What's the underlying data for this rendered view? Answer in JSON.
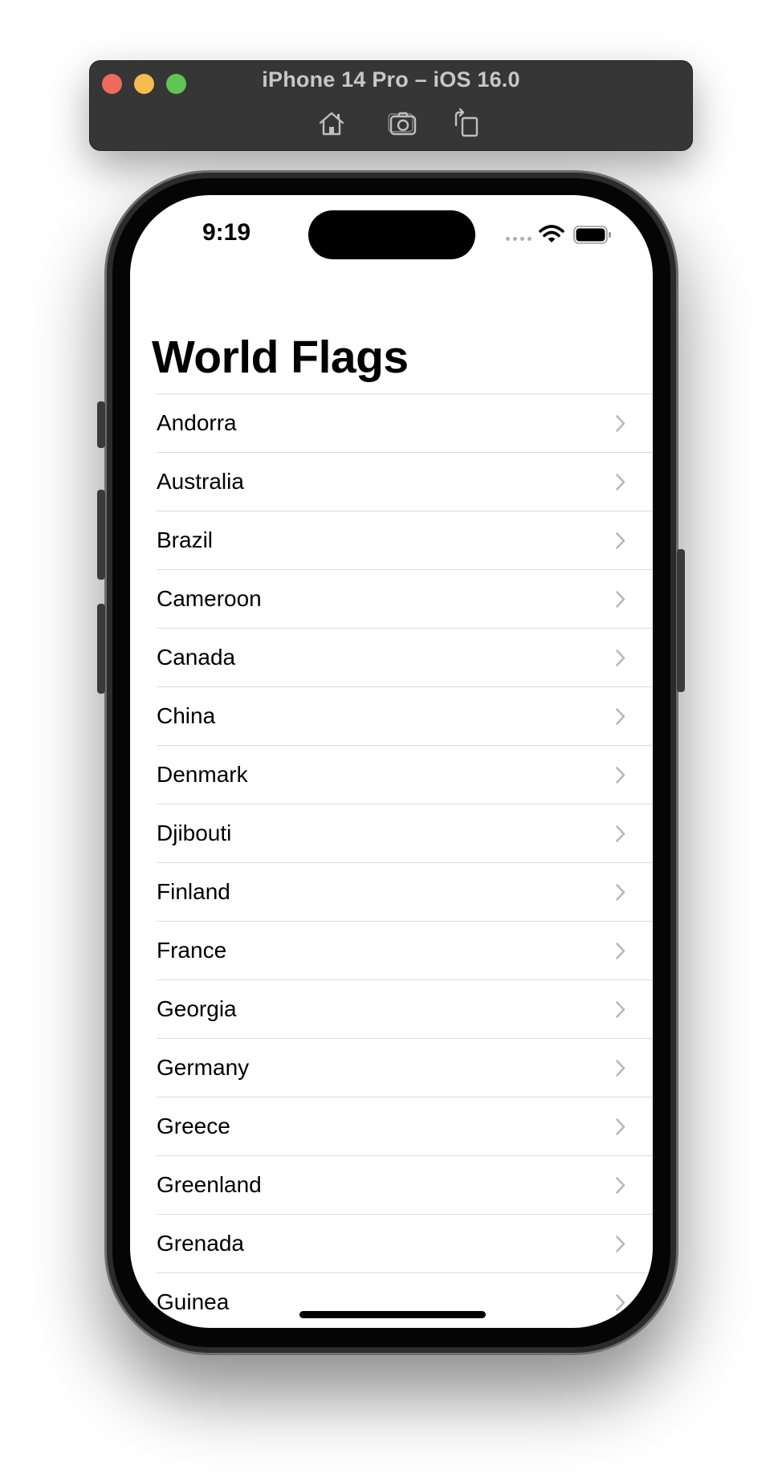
{
  "simulator": {
    "title": "iPhone 14 Pro – iOS 16.0",
    "toolbar_icons": [
      "home-icon",
      "screenshot-icon",
      "rotate-icon"
    ]
  },
  "status_bar": {
    "time": "9:19",
    "icons": [
      "cellular-dots-icon",
      "wifi-icon",
      "battery-icon"
    ]
  },
  "nav": {
    "title": "World Flags"
  },
  "countries": [
    "Andorra",
    "Australia",
    "Brazil",
    "Cameroon",
    "Canada",
    "China",
    "Denmark",
    "Djibouti",
    "Finland",
    "France",
    "Georgia",
    "Germany",
    "Greece",
    "Greenland",
    "Grenada",
    "Guinea"
  ],
  "colors": {
    "traffic_close": "#ee6a5f",
    "traffic_minimize": "#f5bd4f",
    "traffic_maximize": "#61c454",
    "separator": "#dcdcdc",
    "chevron": "#b8b8bd"
  }
}
